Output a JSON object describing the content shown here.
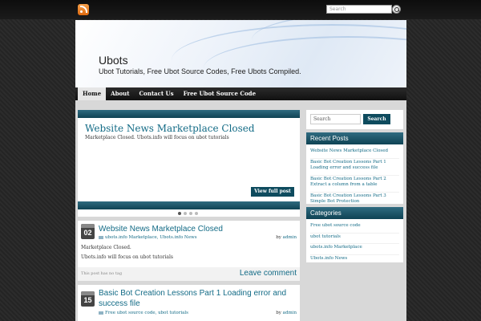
{
  "topbar": {
    "search_placeholder": "Search"
  },
  "header": {
    "title": "Ubots",
    "description": "Ubot Tutorials, Free Ubot Source Codes, Free Ubots Compiled."
  },
  "nav": {
    "items": [
      "Home",
      "About",
      "Contact Us",
      "Free Ubot Source Code"
    ]
  },
  "featured": {
    "title": "Website News Marketplace Closed",
    "excerpt": "Marketplace Closed. Ubots.info will focus on ubot tutorials",
    "button": "View full post"
  },
  "posts": [
    {
      "day": "02",
      "title": "Website News Marketplace Closed",
      "categories": "ubots.info Marketplace, Ubots.info News",
      "by": "by",
      "author": "admin",
      "body": [
        "Marketplace Closed.",
        "Ubots.info will focus on ubot tutorials"
      ],
      "tags": "This post has no tag",
      "comment": "Leave comment"
    },
    {
      "day": "15",
      "title": "Basic Bot Creation Lessons Part 1 Loading error and success file",
      "categories": "Free ubot source code, ubot tutorials",
      "by": "by",
      "author": "admin"
    }
  ],
  "sidebar": {
    "search_placeholder": "Search",
    "search_button": "Search",
    "recent": {
      "title": "Recent Posts",
      "items": [
        "Website News Marketplace Closed",
        "Basic Bot Creation Lessons Part 1 Loading error and success file",
        "Basic Bot Creation Lessons Part 2 Extract a column from a table",
        "Basic Bot Creation Lessons Part 3 Simple Bot Protection"
      ]
    },
    "categories": {
      "title": "Categories",
      "items": [
        "Free ubot source code",
        "ubot tutorials",
        "ubots.info Marketplace",
        "Ubots.info News"
      ]
    }
  },
  "colors": {
    "accent": "#136b86",
    "bar": "#0f4354"
  },
  "icons": {
    "rss": "rss-icon",
    "search": "search-icon"
  }
}
